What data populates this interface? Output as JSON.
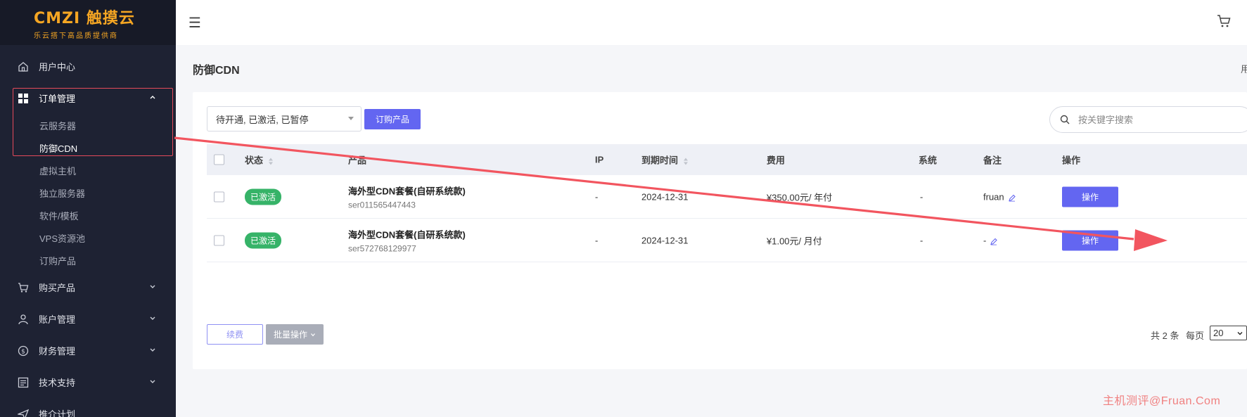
{
  "brand": {
    "logo_text": "CMZI 触摸云",
    "tagline": "乐云搭下高品质提供商"
  },
  "sidebar": {
    "items": [
      {
        "label": "用户中心",
        "icon": "home-icon"
      },
      {
        "label": "订单管理",
        "icon": "grid-icon",
        "expanded": true
      },
      {
        "label": "购买产品",
        "icon": "cart-icon"
      },
      {
        "label": "账户管理",
        "icon": "user-icon"
      },
      {
        "label": "财务管理",
        "icon": "dollar-icon"
      },
      {
        "label": "技术支持",
        "icon": "list-icon"
      },
      {
        "label": "推介计划",
        "icon": "send-icon"
      }
    ],
    "submenu": [
      "云服务器",
      "防御CDN",
      "虚拟主机",
      "独立服务器",
      "软件/模板",
      "VPS资源池",
      "订购产品"
    ]
  },
  "page": {
    "title": "防御CDN",
    "top_right_char": "用"
  },
  "filters": {
    "status_value": "待开通, 已激活, 已暂停",
    "order_button": "订购产品",
    "search_placeholder": "按关键字搜索"
  },
  "table": {
    "headers": {
      "status": "状态",
      "product": "产品",
      "ip": "IP",
      "expire": "到期时间",
      "fee": "费用",
      "system": "系统",
      "note": "备注",
      "action": "操作"
    },
    "rows": [
      {
        "status": "已激活",
        "product_name": "海外型CDN套餐(自研系统款)",
        "product_code": "ser011565447443",
        "ip": "-",
        "expire": "2024-12-31",
        "fee": "¥350.00元/ 年付",
        "system": "-",
        "note": "fruan",
        "action": "操作"
      },
      {
        "status": "已激活",
        "product_name": "海外型CDN套餐(自研系统款)",
        "product_code": "ser572768129977",
        "ip": "-",
        "expire": "2024-12-31",
        "fee": "¥1.00元/ 月付",
        "system": "-",
        "note": "-",
        "action": "操作"
      }
    ]
  },
  "footer": {
    "renew_button": "续费",
    "batch_button": "批量操作",
    "total": "共 2 条",
    "per_page_label": "每页",
    "per_page_value": "20"
  },
  "watermark": "主机测评@Fruan.Com",
  "colors": {
    "sidebar_bg": "#1e2233",
    "accent": "#6366f1",
    "active_badge": "#36b368",
    "annotation": "#e54a5a"
  }
}
